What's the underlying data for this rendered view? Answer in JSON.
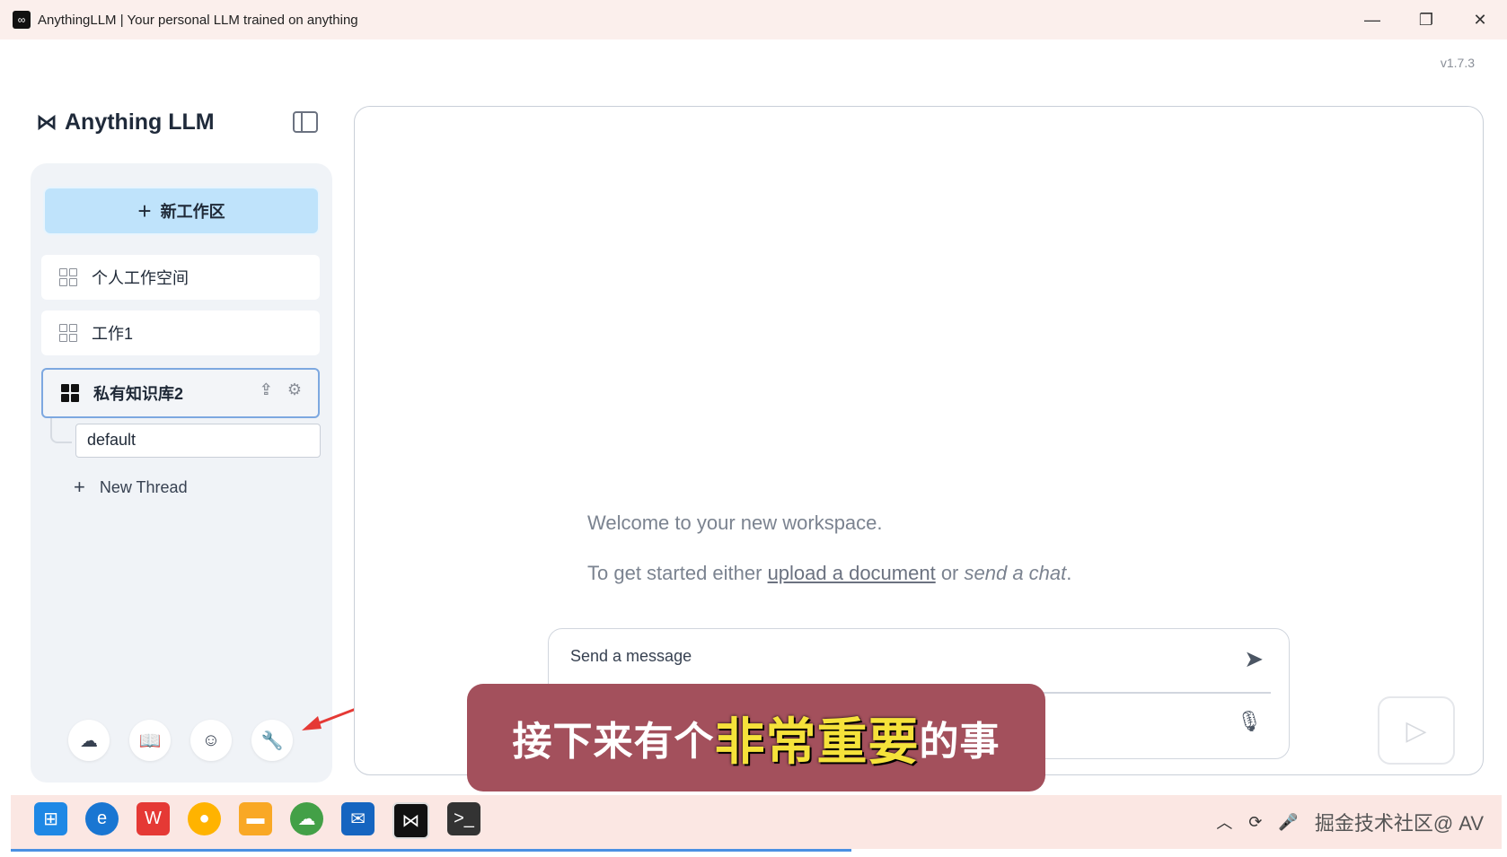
{
  "window": {
    "title": "AnythingLLM | Your personal LLM trained on anything",
    "minimize_glyph": "—",
    "maximize_glyph": "❐",
    "close_glyph": "✕"
  },
  "version": "v1.7.3",
  "sidebar": {
    "logo_text": "Anything LLM",
    "new_workspace_label": "新工作区",
    "workspaces": [
      {
        "label": "个人工作空间"
      },
      {
        "label": "工作1"
      },
      {
        "label": "私有知识库2"
      }
    ],
    "thread_label": "default",
    "new_thread_label": "New Thread",
    "footer_icons": [
      "community-icon",
      "docs-book-icon",
      "discord-icon",
      "settings-wrench-icon"
    ]
  },
  "main": {
    "welcome": "Welcome to your new workspace.",
    "get_started_prefix": "To get started either ",
    "upload_link": "upload a document",
    "or_text": " or ",
    "send_chat_text": "send a chat",
    "period": ".",
    "composer_placeholder": "Send a message"
  },
  "subtitle": {
    "before": "接下来有个",
    "highlight": "非常重要",
    "after": "的事"
  },
  "taskbar": {
    "watermark": "掘金技术社区@ AV"
  },
  "colors": {
    "new_workspace_bg": "#bfe3fb",
    "active_border": "#7da8e0",
    "subtitle_bg": "#a3505c",
    "subtitle_highlight": "#f5e23a",
    "taskbar_bg": "#fbe7e3"
  }
}
